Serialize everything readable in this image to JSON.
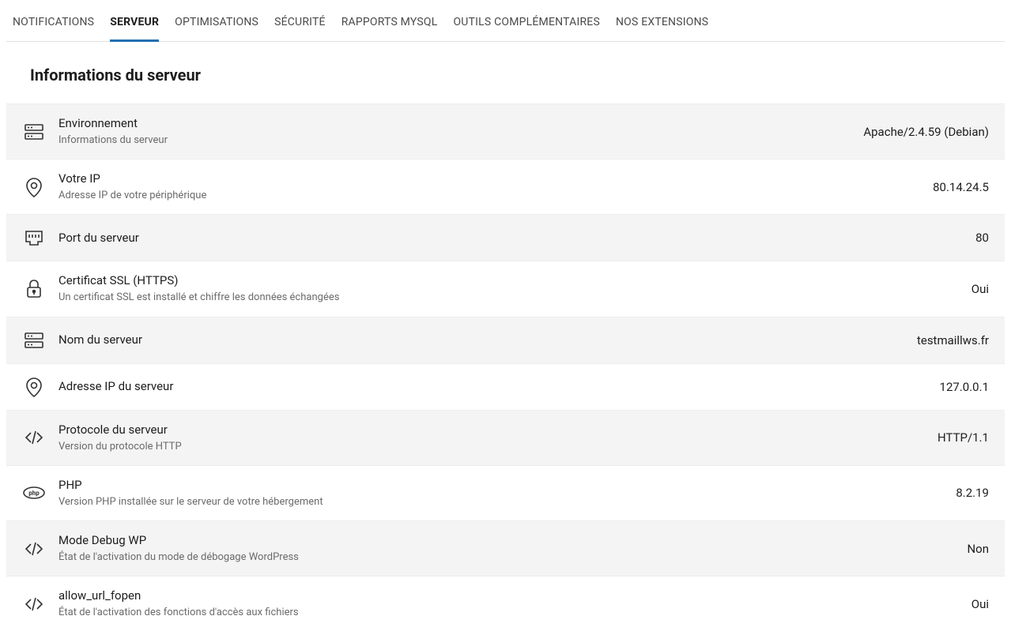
{
  "tabs": [
    {
      "label": "NOTIFICATIONS",
      "active": false
    },
    {
      "label": "SERVEUR",
      "active": true
    },
    {
      "label": "OPTIMISATIONS",
      "active": false
    },
    {
      "label": "SÉCURITÉ",
      "active": false
    },
    {
      "label": "RAPPORTS MYSQL",
      "active": false
    },
    {
      "label": "OUTILS COMPLÉMENTAIRES",
      "active": false
    },
    {
      "label": "NOS EXTENSIONS",
      "active": false
    }
  ],
  "section_title": "Informations du serveur",
  "rows": [
    {
      "icon": "server",
      "title": "Environnement",
      "desc": "Informations du serveur",
      "value": "Apache/2.4.59 (Debian)"
    },
    {
      "icon": "pin",
      "title": "Votre IP",
      "desc": "Adresse IP de votre périphérique",
      "value": "80.14.24.5"
    },
    {
      "icon": "ethernet",
      "title": "Port du serveur",
      "desc": "",
      "value": "80"
    },
    {
      "icon": "lock",
      "title": "Certificat SSL (HTTPS)",
      "desc": "Un certificat SSL est installé et chiffre les données échangées",
      "value": "Oui"
    },
    {
      "icon": "server",
      "title": "Nom du serveur",
      "desc": "",
      "value": "testmaillws.fr"
    },
    {
      "icon": "pin",
      "title": "Adresse IP du serveur",
      "desc": "",
      "value": "127.0.0.1"
    },
    {
      "icon": "code",
      "title": "Protocole du serveur",
      "desc": "Version du protocole HTTP",
      "value": "HTTP/1.1"
    },
    {
      "icon": "php",
      "title": "PHP",
      "desc": "Version PHP installée sur le serveur de votre hébergement",
      "value": "8.2.19"
    },
    {
      "icon": "code",
      "title": "Mode Debug WP",
      "desc": "État de l'activation du mode de débogage WordPress",
      "value": "Non"
    },
    {
      "icon": "code",
      "title": "allow_url_fopen",
      "desc": "État de l'activation des fonctions d'accès aux fichiers",
      "value": "Oui"
    }
  ]
}
